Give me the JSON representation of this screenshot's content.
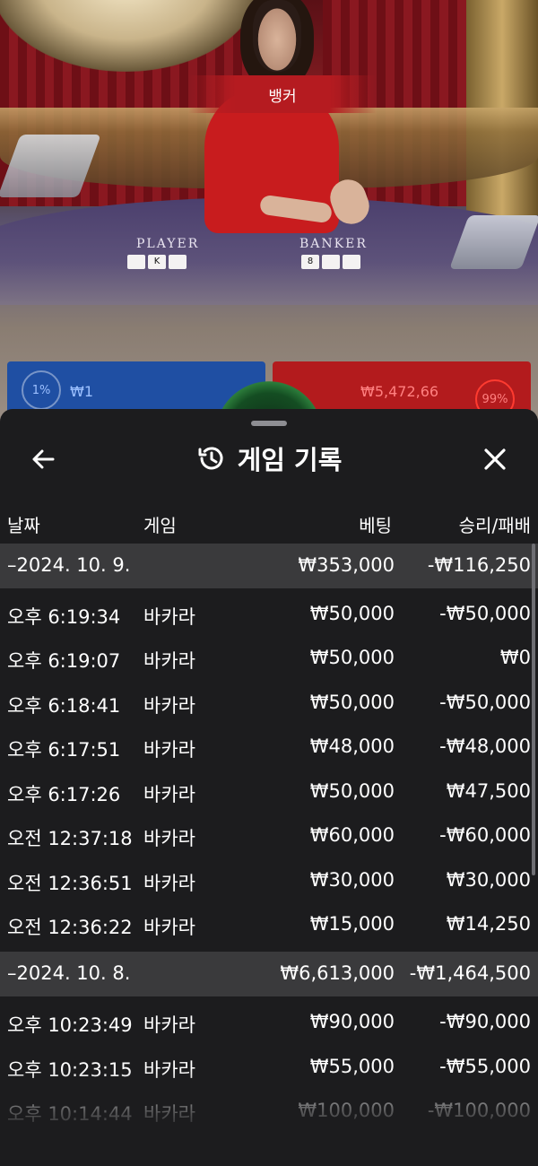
{
  "stream": {
    "winner_banner": "뱅커",
    "table_player_label": "PLAYER",
    "table_banker_label": "BANKER",
    "player_cards": [
      "",
      "K",
      ""
    ],
    "banker_cards": [
      "8",
      "",
      ""
    ],
    "player_bet_pct": "1%",
    "player_bet_amount": "₩1",
    "banker_bet_pct": "99%",
    "banker_bet_amount": "₩5,472,66",
    "player_color": "#1f4fa3",
    "banker_color": "#b31b1d"
  },
  "history": {
    "title": "게임 기록",
    "back_icon": "arrow-left-icon",
    "history_icon": "history-clock-icon",
    "close_icon": "close-icon",
    "columns": {
      "date": "날짜",
      "game": "게임",
      "bet": "베팅",
      "result": "승리/패배"
    },
    "groups": [
      {
        "date": "–2024. 10. 9.",
        "total_bet": "₩353,000",
        "total_result": "-₩116,250",
        "rows": [
          {
            "time": "오후 6:19:34",
            "game": "바카라",
            "bet": "₩50,000",
            "result": "-₩50,000"
          },
          {
            "time": "오후 6:19:07",
            "game": "바카라",
            "bet": "₩50,000",
            "result": "₩0"
          },
          {
            "time": "오후 6:18:41",
            "game": "바카라",
            "bet": "₩50,000",
            "result": "-₩50,000"
          },
          {
            "time": "오후 6:17:51",
            "game": "바카라",
            "bet": "₩48,000",
            "result": "-₩48,000"
          },
          {
            "time": "오후 6:17:26",
            "game": "바카라",
            "bet": "₩50,000",
            "result": "₩47,500"
          },
          {
            "time": "오전 12:37:18",
            "game": "바카라",
            "bet": "₩60,000",
            "result": "-₩60,000"
          },
          {
            "time": "오전 12:36:51",
            "game": "바카라",
            "bet": "₩30,000",
            "result": "₩30,000"
          },
          {
            "time": "오전 12:36:22",
            "game": "바카라",
            "bet": "₩15,000",
            "result": "₩14,250"
          }
        ]
      },
      {
        "date": "–2024. 10. 8.",
        "total_bet": "₩6,613,000",
        "total_result": "-₩1,464,500",
        "rows": [
          {
            "time": "오후 10:23:49",
            "game": "바카라",
            "bet": "₩90,000",
            "result": "-₩90,000"
          },
          {
            "time": "오후 10:23:15",
            "game": "바카라",
            "bet": "₩55,000",
            "result": "-₩55,000"
          },
          {
            "time": "오후 10:14:44",
            "game": "바카라",
            "bet": "₩100,000",
            "result": "-₩100,000"
          }
        ]
      }
    ]
  }
}
